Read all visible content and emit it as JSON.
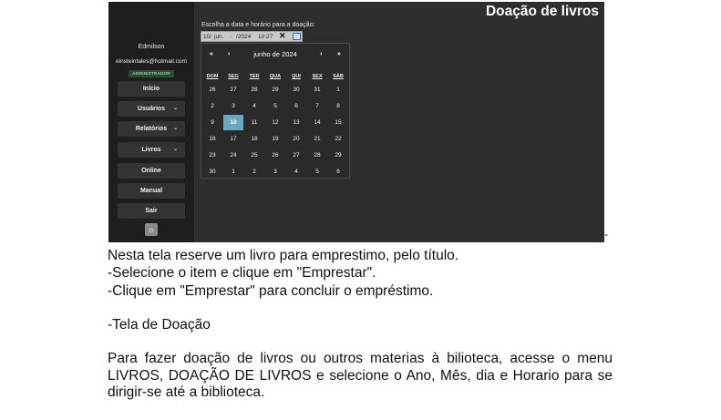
{
  "app": {
    "title": "Doação de livros",
    "user": {
      "name": "Edmilson",
      "email": "einsteintales@hotmail.com",
      "role": "ADMINISTRADOR"
    },
    "nav": [
      {
        "label": "Início",
        "has_chevron": false
      },
      {
        "label": "Usuários",
        "has_chevron": true
      },
      {
        "label": "Relatórios",
        "has_chevron": true
      },
      {
        "label": "Livros",
        "has_chevron": true
      },
      {
        "label": "Online",
        "has_chevron": false
      },
      {
        "label": "Manual",
        "has_chevron": false
      },
      {
        "label": "Sair",
        "has_chevron": false
      }
    ],
    "chevron_glyph": "⌄",
    "theme_icon": "☼",
    "prompt": "Escolha a data e horário para a doação:",
    "datetime": {
      "day": "10/",
      "month": "jun.",
      "sep": "- ",
      "year": "/2024",
      "time": "10:27",
      "clear": "✕"
    },
    "calendar": {
      "month_label": "junho de 2024",
      "prev_year": "«",
      "prev_month": "‹",
      "next_month": "›",
      "next_year": "»",
      "weekdays": [
        "DOM",
        "SEG",
        "TER",
        "QUA",
        "QUI",
        "SEX",
        "SÁB"
      ],
      "weeks": [
        [
          "26",
          "27",
          "28",
          "29",
          "30",
          "31",
          "1"
        ],
        [
          "2",
          "3",
          "4",
          "5",
          "6",
          "7",
          "8"
        ],
        [
          "9",
          "10",
          "11",
          "12",
          "13",
          "14",
          "15"
        ],
        [
          "16",
          "17",
          "18",
          "19",
          "20",
          "21",
          "22"
        ],
        [
          "23",
          "24",
          "25",
          "26",
          "27",
          "28",
          "29"
        ],
        [
          "30",
          "1",
          "2",
          "3",
          "4",
          "5",
          "6"
        ]
      ],
      "selected": "10"
    },
    "colors": {
      "sidebar": "#1e1e1e",
      "main": "#2e2e2e",
      "selected_day": "#6aa8bd",
      "badge_text": "#7fd88a"
    }
  },
  "doc": {
    "trailing_mark": "-",
    "lines": [
      "Nesta tela reserve um livro para emprestimo, pelo título.",
      "-Selecione o item e clique em \"Emprestar\".",
      "-Clique em \"Emprestar\" para concluir o empréstimo."
    ],
    "section_heading": "-Tela de Doação",
    "paragraph": "Para fazer doação de livros ou outros materias à bilioteca, acesse o menu LIVROS, DOAÇÃO DE LIVROS e selecione o Ano, Mês, dia e Horario para se dirigir-se até a biblioteca."
  }
}
